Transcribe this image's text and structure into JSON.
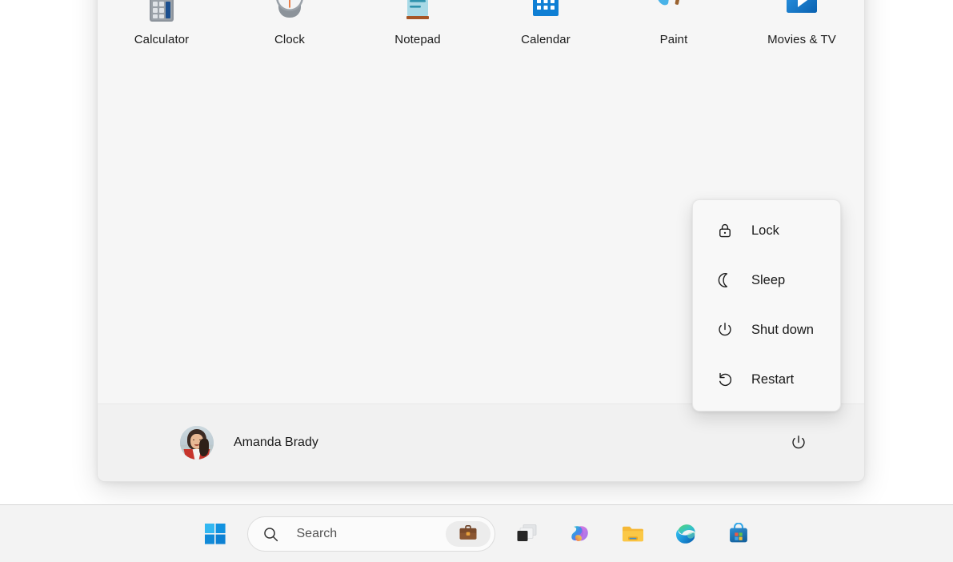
{
  "start_menu": {
    "pinned_apps": [
      {
        "label": "Calculator",
        "icon": "calculator-icon"
      },
      {
        "label": "Clock",
        "icon": "clock-icon"
      },
      {
        "label": "Notepad",
        "icon": "notepad-icon"
      },
      {
        "label": "Calendar",
        "icon": "calendar-icon"
      },
      {
        "label": "Paint",
        "icon": "paint-icon"
      },
      {
        "label": "Movies & TV",
        "icon": "movies-tv-icon"
      }
    ],
    "footer": {
      "account_name": "Amanda Brady",
      "avatar_icon": "user-avatar",
      "power_icon": "power-icon"
    }
  },
  "power_flyout": {
    "items": [
      {
        "label": "Lock",
        "icon": "lock-icon"
      },
      {
        "label": "Sleep",
        "icon": "moon-icon"
      },
      {
        "label": "Shut down",
        "icon": "power-icon"
      },
      {
        "label": "Restart",
        "icon": "restart-icon"
      }
    ]
  },
  "taskbar": {
    "start_label": "Start",
    "search": {
      "placeholder": "Search",
      "search_icon": "search-icon",
      "work_icon": "briefcase-icon"
    },
    "buttons": [
      {
        "name": "task-view",
        "icon": "task-view-icon"
      },
      {
        "name": "copilot",
        "icon": "copilot-icon"
      },
      {
        "name": "file-explorer",
        "icon": "folder-icon"
      },
      {
        "name": "microsoft-edge",
        "icon": "edge-icon"
      },
      {
        "name": "microsoft-store",
        "icon": "store-icon"
      }
    ]
  },
  "colors": {
    "panel_bg": "#f6f6f6",
    "footer_bg": "#f1f1f1",
    "taskbar_bg": "#f3f3f3",
    "accent_blue": "#0f7fd4",
    "text": "#1b1b1b"
  }
}
